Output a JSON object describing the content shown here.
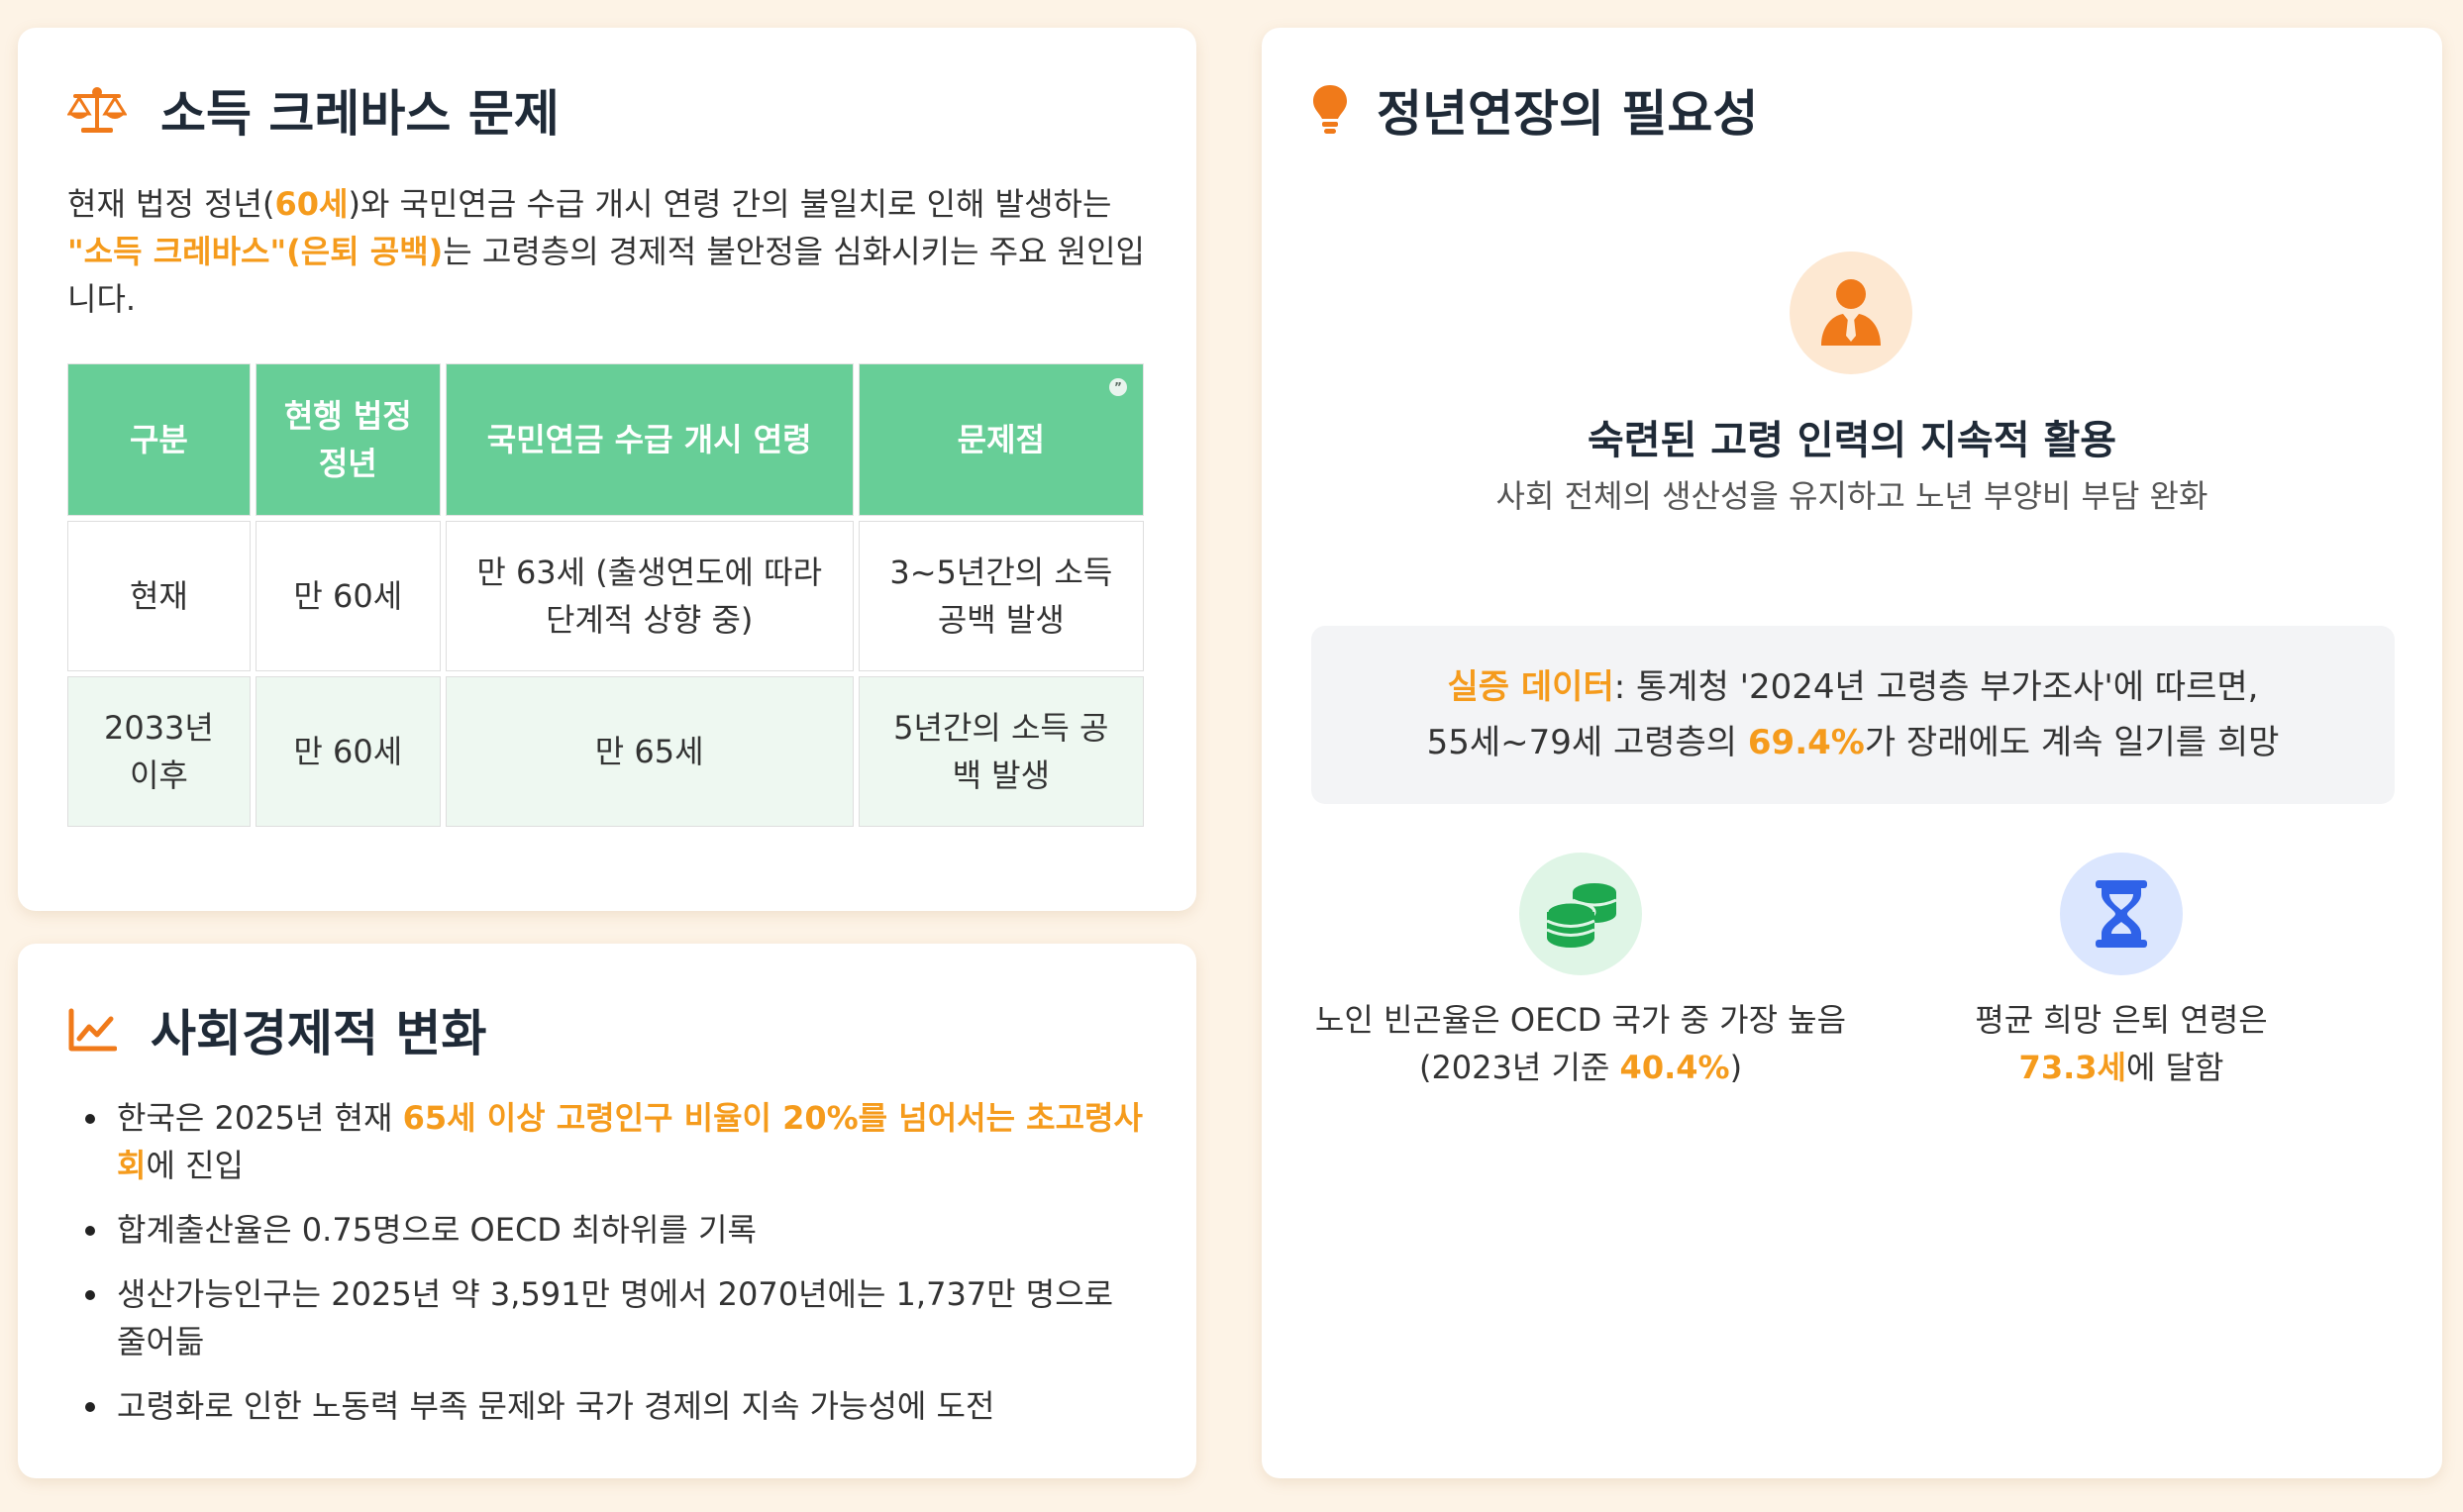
{
  "income_gap": {
    "title": "소득 크레바스 문제",
    "intro_part1": "현재 법정 정년(",
    "intro_hl1": "60세",
    "intro_part2": ")와 국민연금 수급 개시 연령 간의 불일치로 인해 발생하는 ",
    "intro_hl2": "\"소득 크레바스\"(은퇴 공백)",
    "intro_part3": "는 고령층의 경제적 불안정을 심화시키는 주요 원인입니다.",
    "table": {
      "headers": [
        "구분",
        "현행 법정 정년",
        "국민연금 수급 개시 연령",
        "문제점"
      ],
      "rows": [
        [
          "현재",
          "만 60세",
          "만 63세 (출생연도에 따라 단계적 상향 중)",
          "3~5년간의 소득 공백 발생"
        ],
        [
          "2033년 이후",
          "만 60세",
          "만 65세",
          "5년간의 소득 공백 발생"
        ]
      ]
    },
    "quote_mark": "”"
  },
  "social_change": {
    "title": "사회경제적 변화",
    "items": [
      {
        "pre": "한국은 2025년 현재 ",
        "hl": "65세 이상 고령인구 비율이 20%를 넘어서는 초고령사회",
        "post": "에 진입"
      },
      {
        "pre": "합계출산율은 0.75명으로 OECD 최하위를 기록",
        "hl": "",
        "post": ""
      },
      {
        "pre": "생산가능인구는 2025년 약 3,591만 명에서 2070년에는 1,737만 명으로 줄어듦",
        "hl": "",
        "post": ""
      },
      {
        "pre": "고령화로 인한 노동력 부족 문제와 국가 경제의 지속 가능성에 도전",
        "hl": "",
        "post": ""
      }
    ]
  },
  "need": {
    "title": "정년연장의 필요성",
    "labor_title": "숙련된 고령 인력의 지속적 활용",
    "labor_sub": "사회 전체의 생산성을 유지하고 노년 부양비 부담 완화",
    "data_label": "실증 데이터",
    "data_line1": ": 통계청 '2024년 고령층 부가조사'에 따르면,",
    "data_line2_pre": "55세~79세 고령층의 ",
    "data_line2_hl": "69.4%",
    "data_line2_post": "가 장래에도 계속 일기를 희망",
    "poverty_line1": "노인 빈곤율은 OECD 국가 중 가장 높음",
    "poverty_line2_pre": "(2023년 기준 ",
    "poverty_line2_hl": "40.4%",
    "poverty_line2_post": ")",
    "retire_line1": "평균 희망 은퇴 연령은",
    "retire_hl": "73.3세",
    "retire_post": "에 달함"
  },
  "colors": {
    "accent_orange": "#f59b1c",
    "table_header_green": "#67ce97",
    "coin_green": "#1ea84f",
    "hourglass_blue": "#2f62e8"
  },
  "icons": [
    "scale-icon",
    "chart-line-icon",
    "lightbulb-icon",
    "person-tie-icon",
    "coins-icon",
    "hourglass-icon"
  ]
}
